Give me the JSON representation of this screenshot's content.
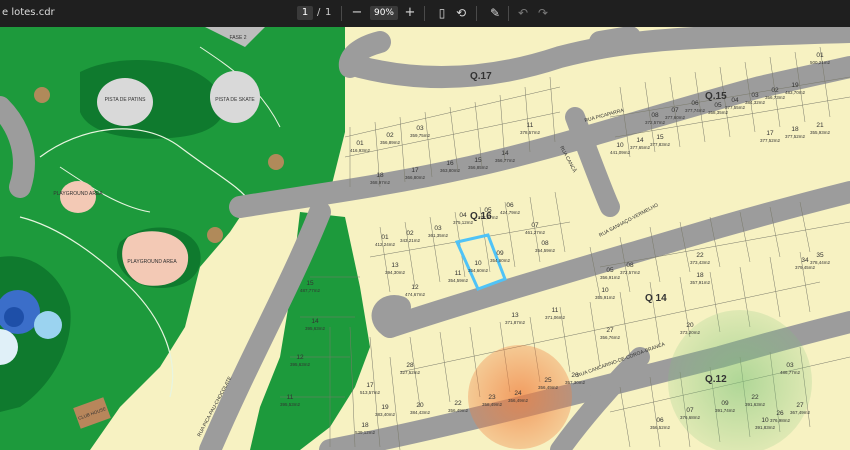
{
  "toolbar": {
    "file_name": "e lotes.cdr",
    "page_current": "1",
    "page_separator": "/",
    "page_total": "1",
    "zoom_out_icon": "minus",
    "zoom_level": "90%",
    "zoom_in_icon": "plus",
    "icons": [
      "fit-page-icon",
      "rotate-icon",
      "annotate-icon",
      "undo-icon",
      "redo-icon"
    ]
  },
  "map": {
    "phase_label": "FASE 2",
    "blocks": [
      "Q.17",
      "Q.15",
      "Q.16",
      "Q 14",
      "Q.12"
    ],
    "streets": [
      "RUA PICAPARRA",
      "RUA SANHAÇO-VERMELHO",
      "RUA CANCÃ",
      "RUA CANCARINO-DE-COROA-BRANCA",
      "RUA PICA-PAU-CHOCOLATE"
    ],
    "amenities": [
      "PISTA DE PATINS",
      "PISTA DE SKATE",
      "PLAYGROUND AREA",
      "PLAYGROUND AREA",
      "CLUB HOUSE"
    ],
    "colors": {
      "park": "#1d9a3c",
      "park_dark": "#0f7a2e",
      "lot": "#f7f2c2",
      "street": "#9c9c9c",
      "highlight": "#4fc3f7",
      "circle": "#f28c50"
    }
  },
  "lots_q16": [
    {
      "n": "01",
      "a": "412,24m2"
    },
    {
      "n": "02",
      "a": "343,21m2"
    },
    {
      "n": "03",
      "a": "361,35m2"
    },
    {
      "n": "04",
      "a": "375,12m2"
    },
    {
      "n": "05",
      "a": "372,57m2"
    },
    {
      "n": "06",
      "a": "424,79m2"
    },
    {
      "n": "07",
      "a": "461,27m2"
    },
    {
      "n": "08",
      "a": "354,59m2"
    },
    {
      "n": "09",
      "a": "354,60m2"
    },
    {
      "n": "10",
      "a": "354,60m2"
    },
    {
      "n": "11",
      "a": "354,59m2"
    },
    {
      "n": "12",
      "a": "474,67m2"
    },
    {
      "n": "13",
      "a": "394,30m2"
    }
  ],
  "lots_q17": [
    {
      "n": "01",
      "a": "416,93m2"
    },
    {
      "n": "02",
      "a": "356,89m2"
    },
    {
      "n": "03",
      "a": "359,75m2"
    },
    {
      "n": "11",
      "a": "378,57m2"
    },
    {
      "n": "14",
      "a": "356,77m2"
    },
    {
      "n": "15",
      "a": "356,85m2"
    },
    {
      "n": "16",
      "a": "363,80m2"
    },
    {
      "n": "17",
      "a": "366,80m2"
    },
    {
      "n": "18",
      "a": "368,97m2"
    }
  ],
  "lots_q15": [
    {
      "n": "01",
      "a": "500,21m2"
    },
    {
      "n": "02",
      "a": "356,73m2"
    },
    {
      "n": "03",
      "a": "384,32m2"
    },
    {
      "n": "04",
      "a": "377,55m2"
    },
    {
      "n": "05",
      "a": "358,35m2"
    },
    {
      "n": "06",
      "a": "377,74m2"
    },
    {
      "n": "07",
      "a": "377,60m2"
    },
    {
      "n": "08",
      "a": "372,57m2"
    },
    {
      "n": "10",
      "a": "441,09m2"
    },
    {
      "n": "14",
      "a": "377,65m2"
    },
    {
      "n": "15",
      "a": "377,83m2"
    },
    {
      "n": "17",
      "a": "377,52m2"
    },
    {
      "n": "18",
      "a": "377,52m2"
    },
    {
      "n": "21",
      "a": "355,93m2"
    },
    {
      "n": "19",
      "a": "483,70m2"
    }
  ],
  "lots_q14": [
    {
      "n": "05",
      "a": "356,91m2"
    },
    {
      "n": "08",
      "a": "372,57m2"
    },
    {
      "n": "10",
      "a": "355,91m2"
    },
    {
      "n": "11",
      "a": "371,06m2"
    },
    {
      "n": "13",
      "a": "371,87m2"
    },
    {
      "n": "34",
      "a": "379,45m2"
    },
    {
      "n": "35",
      "a": "378,44m2"
    },
    {
      "n": "22",
      "a": "373,43m2"
    },
    {
      "n": "18",
      "a": "357,91m2"
    },
    {
      "n": "20",
      "a": "373,20m2"
    },
    {
      "n": "27",
      "a": "356,76m2"
    }
  ],
  "lots_south": [
    {
      "n": "15",
      "a": "487,77m2"
    },
    {
      "n": "14",
      "a": "395,63m2"
    },
    {
      "n": "12",
      "a": "395,63m2"
    },
    {
      "n": "11",
      "a": "395,53m2"
    },
    {
      "n": "17",
      "a": "513,57m2"
    },
    {
      "n": "18",
      "a": "539,12m2"
    },
    {
      "n": "19",
      "a": "383,40m2"
    },
    {
      "n": "20",
      "a": "384,43m2"
    },
    {
      "n": "22",
      "a": "356,49m2"
    },
    {
      "n": "23",
      "a": "358,49m2"
    },
    {
      "n": "24",
      "a": "356,49m2"
    },
    {
      "n": "25",
      "a": "356,49m2"
    },
    {
      "n": "26",
      "a": "357,30m2"
    },
    {
      "n": "28",
      "a": "327,52m2"
    }
  ],
  "lots_q12": [
    {
      "n": "03",
      "a": "486,77m2"
    },
    {
      "n": "06",
      "a": "356,52m2"
    },
    {
      "n": "07",
      "a": "376,68m2"
    },
    {
      "n": "09",
      "a": "391,74m2"
    },
    {
      "n": "22",
      "a": "391,63m2"
    },
    {
      "n": "26",
      "a": "376,98m2"
    },
    {
      "n": "27",
      "a": "367,49m2"
    },
    {
      "n": "10",
      "a": "391,83m2"
    }
  ]
}
